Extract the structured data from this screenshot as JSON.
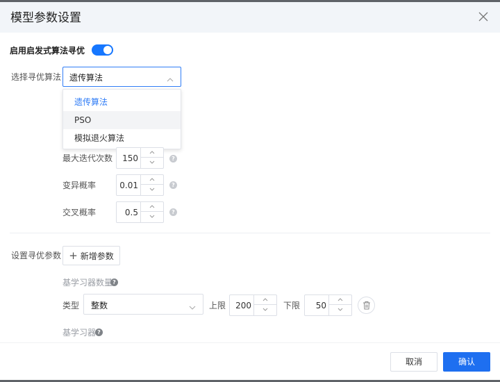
{
  "dialog": {
    "title": "模型参数设置",
    "close_icon": "close-icon"
  },
  "optimization": {
    "enable_label": "启用启发式算法寻优",
    "enabled": true,
    "algorithm_label": "选择寻优算法",
    "algorithm_value": "遗传算法",
    "options": [
      "遗传算法",
      "PSO",
      "模拟退火算法"
    ],
    "selected_option": "遗传算法"
  },
  "params": [
    {
      "label": "最大迭代次数",
      "value": "150"
    },
    {
      "label": "变异概率",
      "value": "0.01"
    },
    {
      "label": "交叉概率",
      "value": "0.5"
    }
  ],
  "tune_params": {
    "label": "设置寻优参数",
    "add_button": "新增参数",
    "add_icon": "plus-icon",
    "group1_title": "基学习器数量",
    "type_label": "类型",
    "type_value": "整数",
    "upper_label": "上限",
    "upper_value": "200",
    "lower_label": "下限",
    "lower_value": "50",
    "delete_icon": "trash-icon",
    "group2_title": "基学习器"
  },
  "footer": {
    "cancel": "取消",
    "confirm": "确认"
  },
  "colors": {
    "accent": "#1677ff",
    "primary_button": "#1e6ff0",
    "header_bg": "#f2f5f9"
  }
}
